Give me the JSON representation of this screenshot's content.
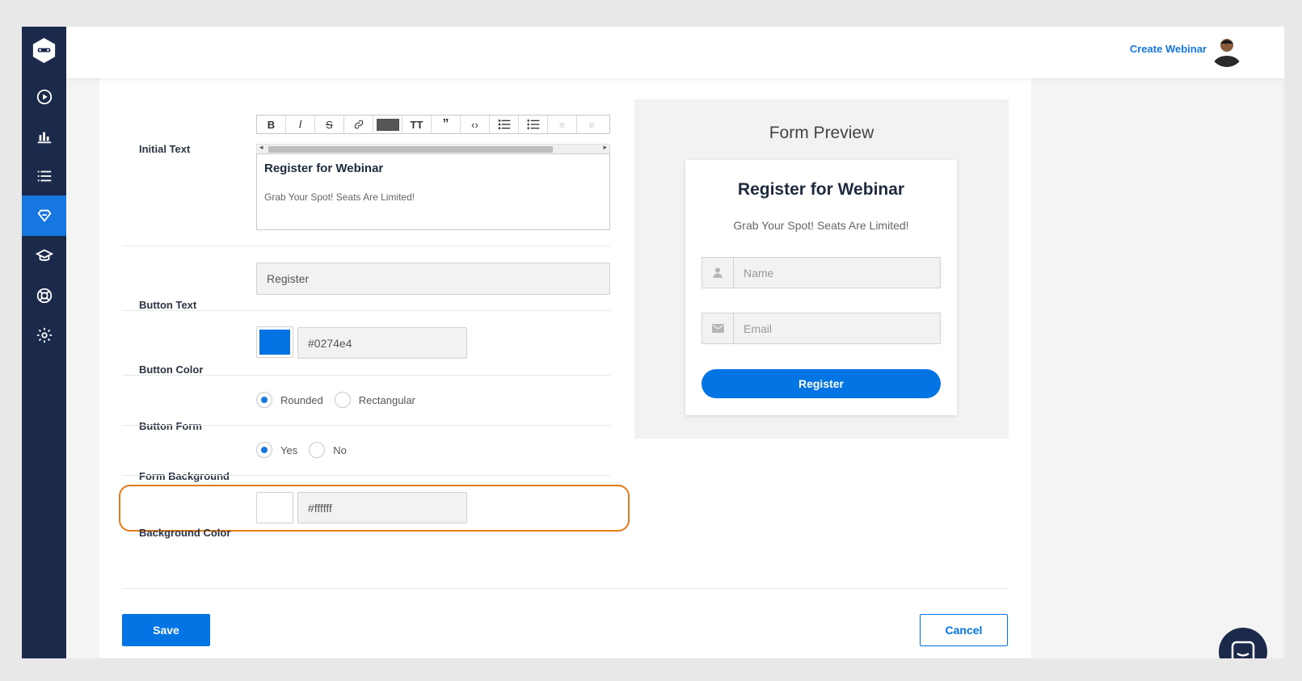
{
  "header": {
    "create_link": "Create Webinar"
  },
  "sidebar": {
    "items": [
      {
        "icon": "play-circle-icon"
      },
      {
        "icon": "bar-chart-icon"
      },
      {
        "icon": "list-icon"
      },
      {
        "icon": "registration-form-icon",
        "active": true
      },
      {
        "icon": "graduation-cap-icon"
      },
      {
        "icon": "lifebuoy-icon"
      },
      {
        "icon": "gear-icon"
      }
    ]
  },
  "form": {
    "initial_text_label": "Initial Text",
    "toolbar": [
      "B",
      "I",
      "S",
      "link",
      "color",
      "text-size",
      "quote",
      "code",
      "bullet-list",
      "numbered-list",
      "outdent",
      "indent"
    ],
    "editor_title": "Register for Webinar",
    "editor_sub": "Grab Your Spot! Seats Are Limited!",
    "button_text_label": "Button Text",
    "button_text_value": "Register",
    "button_color_label": "Button Color",
    "button_color_value": "#0274e4",
    "button_form_label": "Button Form",
    "button_form_options": [
      "Rounded",
      "Rectangular"
    ],
    "button_form_selected": "Rounded",
    "form_background_label": "Form Background",
    "form_background_options": [
      "Yes",
      "No"
    ],
    "form_background_selected": "Yes",
    "background_color_label": "Background Color",
    "background_color_value": "#ffffff"
  },
  "preview": {
    "heading": "Form Preview",
    "title": "Register for Webinar",
    "subtitle": "Grab Your Spot! Seats Are Limited!",
    "name_placeholder": "Name",
    "email_placeholder": "Email",
    "button_label": "Register"
  },
  "actions": {
    "save": "Save",
    "cancel": "Cancel"
  },
  "colors": {
    "accent": "#0274e4",
    "sidebar": "#1b2a4a",
    "highlight": "#e07b18"
  }
}
